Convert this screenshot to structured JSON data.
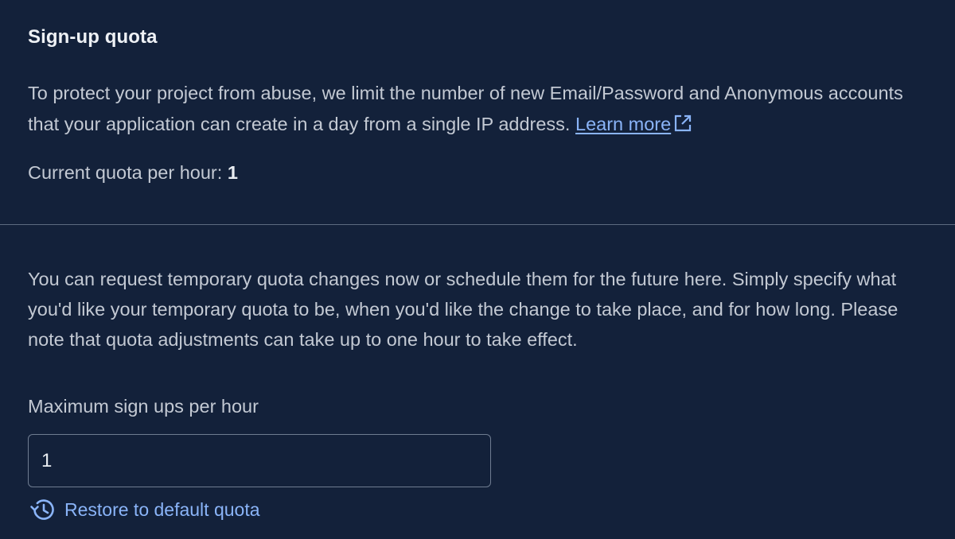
{
  "section": {
    "title": "Sign-up quota",
    "description": "To protect your project from abuse, we limit the number of new Email/Password and Anonymous accounts that your application can create in a day from a single IP address.",
    "learn_more_label": "Learn more",
    "current_quota_label": "Current quota per hour:",
    "current_quota_value": "1"
  },
  "temporary": {
    "info_text": "You can request temporary quota changes now or schedule them for the future here. Simply specify what you'd like your temporary quota to be, when you'd like the change to take place, and for how long. Please note that quota adjustments can take up to one hour to take effect.",
    "field_label": "Maximum sign ups per hour",
    "field_value": "1",
    "restore_label": "Restore to default quota"
  },
  "icons": {
    "external_link": "open-in-new-icon",
    "restore": "history-icon"
  },
  "colors": {
    "background": "#13213a",
    "link": "#8ab4f8",
    "text": "#c3c9d3",
    "title": "#eef1f5"
  }
}
